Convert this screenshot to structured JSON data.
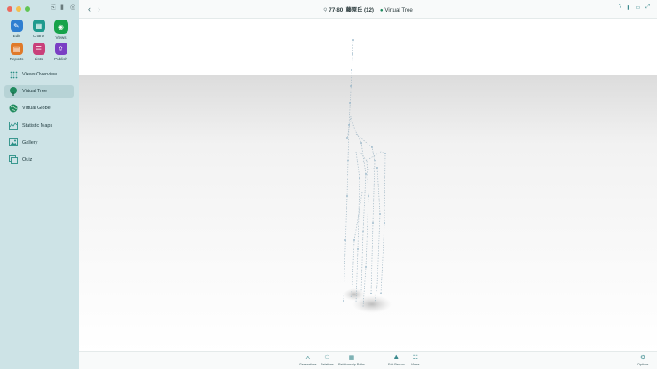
{
  "colors": {
    "sidebar_bg": "#cde3e6",
    "accent": "#1aa39a",
    "traffic_red": "#ec6a5e",
    "traffic_yellow": "#f4bf4f",
    "traffic_green": "#61c554"
  },
  "toolbar": {
    "icons": [
      "paperclip-icon",
      "bookmark-icon",
      "people-icon"
    ]
  },
  "tools": [
    {
      "label": "Edit",
      "icon": "pencil-icon",
      "color": "#2f7fd1"
    },
    {
      "label": "Charts",
      "icon": "grid-chart-icon",
      "color": "#1f9a8e"
    },
    {
      "label": "Views",
      "icon": "eye-icon",
      "color": "#16a34a",
      "selected": true
    },
    {
      "label": "Reports",
      "icon": "report-icon",
      "color": "#e07a2a"
    },
    {
      "label": "Lists",
      "icon": "list-icon",
      "color": "#c9407a"
    },
    {
      "label": "Publish",
      "icon": "upload-icon",
      "color": "#7a3fc4"
    }
  ],
  "nav": [
    {
      "label": "Views Overview",
      "icon": "grid-dots-icon"
    },
    {
      "label": "Virtual Tree",
      "icon": "tree-icon",
      "active": true
    },
    {
      "label": "Virtual Globe",
      "icon": "globe-icon"
    },
    {
      "label": "Statistic Maps",
      "icon": "map-icon"
    },
    {
      "label": "Gallery",
      "icon": "image-icon"
    },
    {
      "label": "Quiz",
      "icon": "quiz-icon"
    }
  ],
  "header": {
    "back_icon": "chevron-left-icon",
    "forward_icon": "chevron-right-icon",
    "person_title": "77-80_藤原氏 (12)",
    "view_title": "Virtual Tree",
    "right_icons": [
      "help-icon",
      "bookmark-icon",
      "window-icon",
      "expand-icon"
    ]
  },
  "bottombar": {
    "items": [
      {
        "label": "Generations",
        "icon": "generations-icon"
      },
      {
        "label": "Relatives",
        "icon": "relatives-icon"
      },
      {
        "label": "Relationship Paths",
        "icon": "paths-icon"
      },
      {
        "label": "Edit Person",
        "icon": "person-icon"
      },
      {
        "label": "Views",
        "icon": "views-icon"
      },
      {
        "label": "Options",
        "icon": "gear-icon"
      }
    ]
  }
}
